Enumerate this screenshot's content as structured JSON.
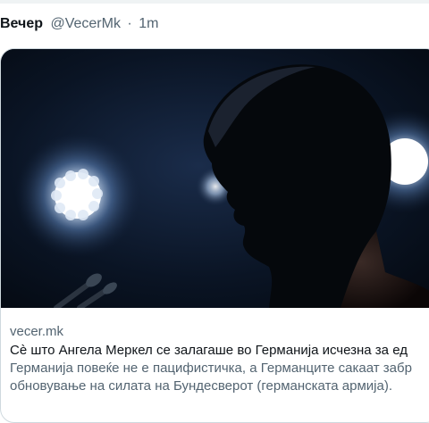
{
  "tweet": {
    "author_name": "Вечер",
    "handle": "@VecerMk",
    "separator": "·",
    "time": "1m"
  },
  "card": {
    "image_icon": "photo-image",
    "domain": "vecer.mk",
    "title": "Сè што Ангела Меркел се залагаше во Германија исчезна за ед",
    "description_line1": "Германија повеќе не е пацифистичка, а Германците сакаат забр",
    "description_line2": "обновување на силата на Бундесверот (германската армија)."
  },
  "colors": {
    "text_primary": "#0f1419",
    "text_secondary": "#536471",
    "border": "#cfd9de"
  }
}
